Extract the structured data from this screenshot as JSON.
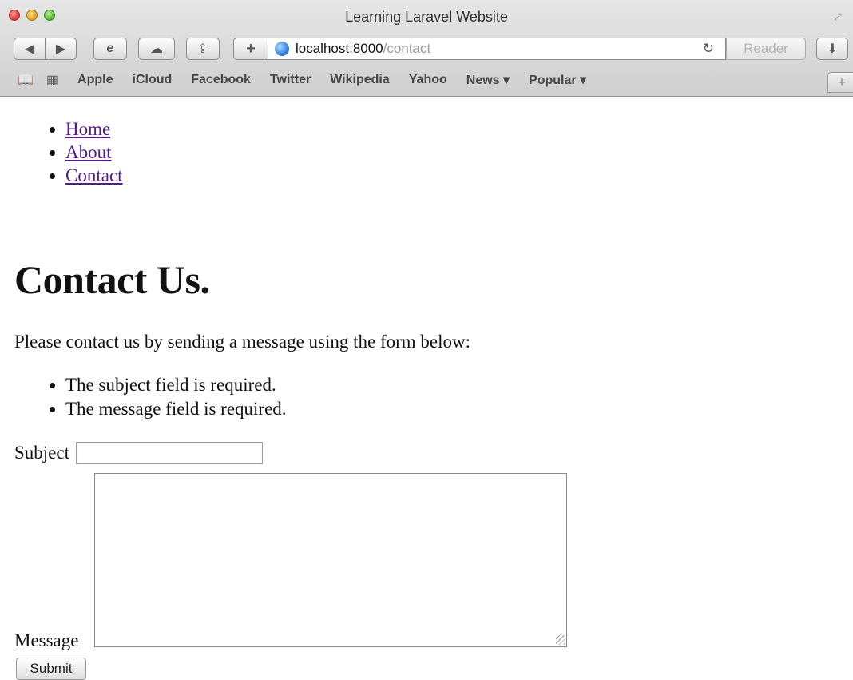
{
  "browser": {
    "window_title": "Learning Laravel Website",
    "url_host": "localhost:8000",
    "url_path": "/contact",
    "reader_label": "Reader",
    "bookmarks": [
      "Apple",
      "iCloud",
      "Facebook",
      "Twitter",
      "Wikipedia",
      "Yahoo",
      "News ▾",
      "Popular ▾"
    ]
  },
  "nav": {
    "items": [
      "Home",
      "About",
      "Contact"
    ]
  },
  "page": {
    "heading": "Contact Us.",
    "intro": "Please contact us by sending a message using the form below:",
    "errors": [
      "The subject field is required.",
      "The message field is required."
    ]
  },
  "form": {
    "subject_label": "Subject",
    "subject_value": "",
    "message_label": "Message",
    "message_value": "",
    "submit_label": "Submit"
  }
}
